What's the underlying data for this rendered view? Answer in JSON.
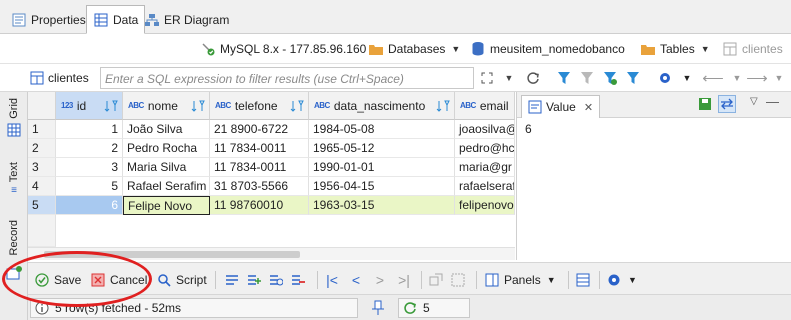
{
  "tabs": [
    {
      "label": "Properties",
      "icon": "properties-icon",
      "active": false
    },
    {
      "label": "Data",
      "icon": "data-grid-icon",
      "active": true
    },
    {
      "label": "ER Diagram",
      "icon": "er-diagram-icon",
      "active": false
    }
  ],
  "connection": {
    "datasource": "MySQL 8.x - 177.85.96.160",
    "databases_label": "Databases",
    "schema": "meusitem_nomedobanco",
    "tables_label": "Tables",
    "table": "clientes"
  },
  "filter": {
    "table_chip": "clientes",
    "placeholder": "Enter a SQL expression to filter results (use Ctrl+Space)"
  },
  "side_tabs": [
    "Grid",
    "Text",
    "Record"
  ],
  "grid": {
    "columns": [
      {
        "type": "123",
        "name": "id"
      },
      {
        "type": "ABC",
        "name": "nome"
      },
      {
        "type": "ABC",
        "name": "telefone"
      },
      {
        "type": "ABC",
        "name": "data_nascimento"
      },
      {
        "type": "ABC",
        "name": "email"
      }
    ],
    "rows": [
      {
        "n": "1",
        "id": "1",
        "nome": "João Silva",
        "telefone": "21 8900-6722",
        "data_nascimento": "1984-05-08",
        "email": "joaosilva@"
      },
      {
        "n": "2",
        "id": "2",
        "nome": "Pedro Rocha",
        "telefone": "11 7834-0011",
        "data_nascimento": "1965-05-12",
        "email": "pedro@hc"
      },
      {
        "n": "3",
        "id": "3",
        "nome": "Maria Silva",
        "telefone": "11 7834-0011",
        "data_nascimento": "1990-01-01",
        "email": "maria@gr"
      },
      {
        "n": "4",
        "id": "5",
        "nome": "Rafael Serafim",
        "telefone": "31 8703-5566",
        "data_nascimento": "1956-04-15",
        "email": "rafaelseraf"
      },
      {
        "n": "5",
        "id": "6",
        "nome": "Felipe Novo",
        "telefone": "11 98760010",
        "data_nascimento": "1963-03-15",
        "email": "felipenovo"
      }
    ]
  },
  "value_panel": {
    "tab_label": "Value",
    "content": "6"
  },
  "bottom_toolbar": {
    "save": "Save",
    "cancel": "Cancel",
    "script": "Script",
    "panels": "Panels"
  },
  "status": {
    "fetched": "5 row(s) fetched - 52ms",
    "refresh_count": "5"
  },
  "colors": {
    "accent": "#2a62c9",
    "selection_row": "#eaf6c6",
    "header_selected": "#c9dcf4",
    "annotation_circle": "#e02020"
  }
}
